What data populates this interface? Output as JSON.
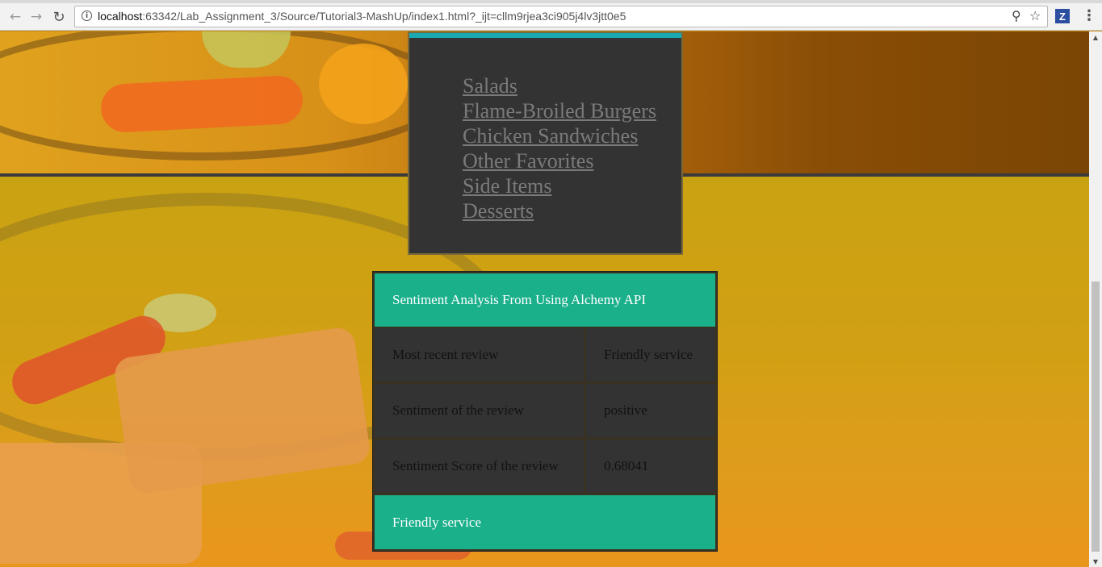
{
  "browser": {
    "url_host": "localhost",
    "url_rest": ":63342/Lab_Assignment_3/Source/Tutorial3-MashUp/index1.html?_ijt=cllm9rjea3ci905j4lv3jtt0e5",
    "extension_label": "Z"
  },
  "menu": {
    "items": [
      {
        "label": "Salads"
      },
      {
        "label": "Flame-Broiled Burgers"
      },
      {
        "label": "Chicken Sandwiches"
      },
      {
        "label": "Other Favorites"
      },
      {
        "label": "Side Items"
      },
      {
        "label": "Desserts"
      }
    ]
  },
  "sentiment": {
    "header": "Sentiment Analysis From Using Alchemy API",
    "rows": [
      {
        "label": "Most recent review",
        "value": "Friendly service"
      },
      {
        "label": "Sentiment of the review",
        "value": "positive"
      },
      {
        "label": "Sentiment Score of the review",
        "value": "0.68041"
      }
    ],
    "footer": "Friendly service"
  },
  "colors": {
    "teal": "#1ab08a",
    "panel": "#333333",
    "menu_link": "#7a7a7a"
  }
}
